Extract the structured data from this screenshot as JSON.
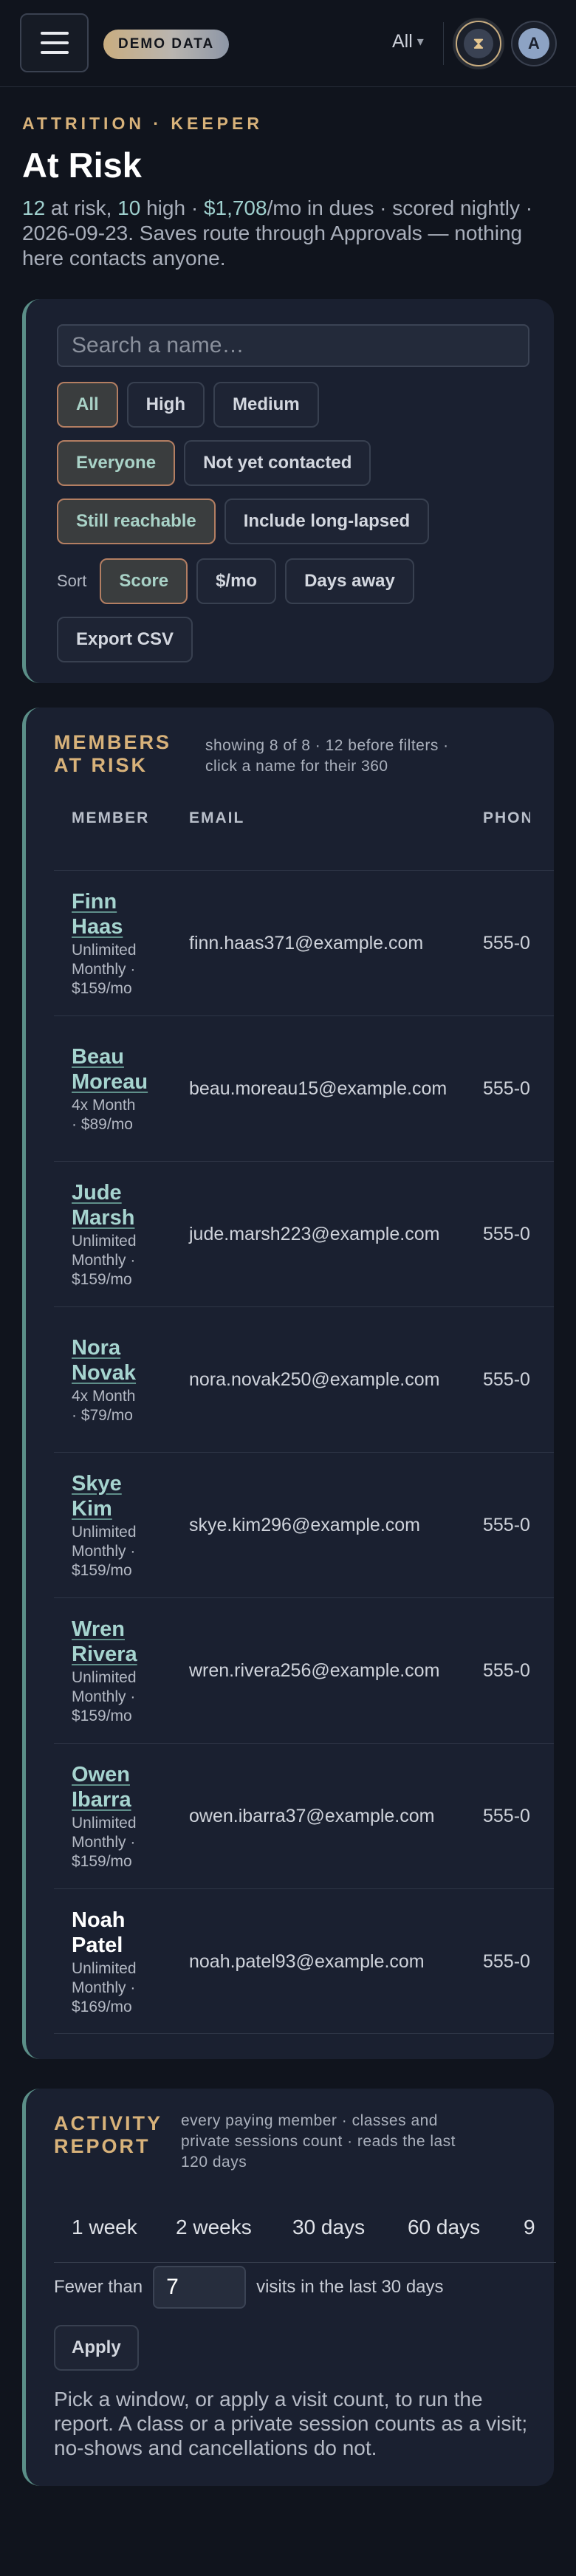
{
  "topbar": {
    "demo_badge": "DEMO DATA",
    "scope_select": "All",
    "hourglass_glyph": "⧗",
    "avatar_initial": "A"
  },
  "page": {
    "eyebrow": "ATTRITION · KEEPER",
    "title": "At Risk",
    "summary": {
      "at_risk_count": "12",
      "at_risk_label": " at risk, ",
      "high_count": "10",
      "high_label": " high · ",
      "dues": "$1,708",
      "dues_label": "/mo in dues · scored nightly · 2026-09-23. Saves route through Approvals — nothing here contacts anyone."
    }
  },
  "filters": {
    "search_placeholder": "Search a name…",
    "risk_levels": [
      "All",
      "High",
      "Medium"
    ],
    "contact_filters": [
      "Everyone",
      "Not yet contacted"
    ],
    "reach_filters": [
      "Still reachable",
      "Include long-lapsed"
    ],
    "sort_label": "Sort",
    "sort_options": [
      "Score",
      "$/mo",
      "Days away"
    ],
    "export_label": "Export CSV",
    "active": {
      "risk": "All",
      "contact": "Everyone",
      "reach": "Still reachable",
      "sort": "Score"
    }
  },
  "members": {
    "title_line1": "MEMBERS",
    "title_line2": "AT RISK",
    "subtitle_line1": "showing 8 of 8 · 12 before filters ·",
    "subtitle_line2": "click a name for their 360",
    "columns": [
      "MEMBER",
      "EMAIL",
      "PHONE"
    ],
    "rows": [
      {
        "name_l1": "Finn",
        "name_l2": "Haas",
        "plan_lines": [
          "Unlimited",
          "Monthly ·",
          "$159/mo"
        ],
        "email": "finn.haas371@example.com",
        "phone": "555-0",
        "linked": true
      },
      {
        "name_l1": "Beau",
        "name_l2": "Moreau",
        "plan_lines": [
          "4x Month",
          "· $89/mo"
        ],
        "email": "beau.moreau15@example.com",
        "phone": "555-0",
        "linked": true
      },
      {
        "name_l1": "Jude",
        "name_l2": "Marsh",
        "plan_lines": [
          "Unlimited",
          "Monthly ·",
          "$159/mo"
        ],
        "email": "jude.marsh223@example.com",
        "phone": "555-0",
        "linked": true
      },
      {
        "name_l1": "Nora",
        "name_l2": "Novak",
        "plan_lines": [
          "4x Month",
          "· $79/mo"
        ],
        "email": "nora.novak250@example.com",
        "phone": "555-0",
        "linked": true
      },
      {
        "name_l1": "Skye",
        "name_l2": "Kim",
        "plan_lines": [
          "Unlimited",
          "Monthly ·",
          "$159/mo"
        ],
        "email": "skye.kim296@example.com",
        "phone": "555-0",
        "linked": true
      },
      {
        "name_l1": "Wren",
        "name_l2": "Rivera",
        "plan_lines": [
          "Unlimited",
          "Monthly ·",
          "$159/mo"
        ],
        "email": "wren.rivera256@example.com",
        "phone": "555-0",
        "linked": true
      },
      {
        "name_l1": "Owen",
        "name_l2": "Ibarra",
        "plan_lines": [
          "Unlimited",
          "Monthly ·",
          "$159/mo"
        ],
        "email": "owen.ibarra37@example.com",
        "phone": "555-0",
        "linked": true
      },
      {
        "name_l1": "Noah",
        "name_l2": "Patel",
        "plan_lines": [
          "Unlimited",
          "Monthly ·",
          "$169/mo"
        ],
        "email": "noah.patel93@example.com",
        "phone": "555-0",
        "linked": false
      }
    ]
  },
  "activity": {
    "title_line1": "ACTIVITY",
    "title_line2": "REPORT",
    "subtitle_lines": [
      "every paying member · classes and",
      "private sessions count · reads the last",
      "120 days"
    ],
    "windows": [
      "1 week",
      "2 weeks",
      "30 days",
      "60 days",
      "9"
    ],
    "fewer_than_label": "Fewer than",
    "fewer_than_value": "7",
    "fewer_than_suffix": "visits in the last 30 days",
    "apply_label": "Apply",
    "note": "Pick a window, or apply a visit count, to run the report. A class or a private session counts as a visit; no-shows and cancellations do not."
  }
}
